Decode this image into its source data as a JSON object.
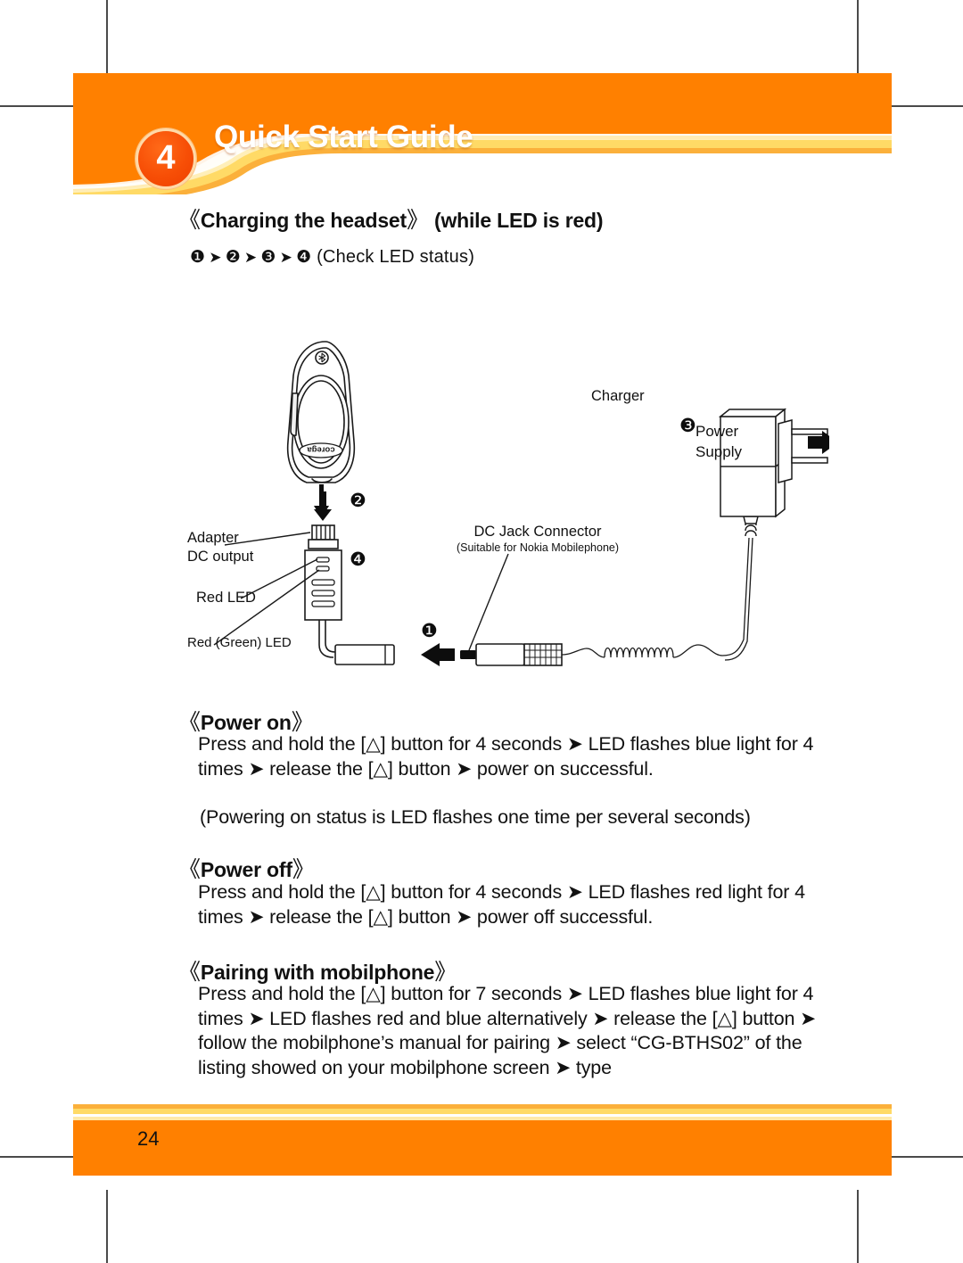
{
  "document": {
    "page_number": "24",
    "header_title": "Quick Start Guide",
    "badge_number": "4"
  },
  "colors": {
    "header_orange": "#FF8000",
    "badge_red": "#F74E06",
    "ribbon_yellow": "#FFDA66",
    "ribbon_gold": "#FBB03B",
    "text_black": "#111111",
    "line_gray": "#4A4A4A"
  },
  "sections": {
    "charging": {
      "open_bracket": "《",
      "title": "Charging the headset",
      "close_bracket": "》",
      "suffix": "(while LED is red)",
      "steps": {
        "items": [
          "❶",
          "❷",
          "❸",
          "❹"
        ],
        "arrow": "➤",
        "note": "(Check LED status)"
      }
    },
    "power_on": {
      "open_bracket": "《",
      "title": "Power on",
      "close_bracket": "》",
      "body": "Press and hold the [△] button for 4 seconds ➤ LED flashes blue light for 4 times ➤ release the [△] button ➤ power on successful.",
      "note": "(Powering on status is LED flashes one time per several seconds)"
    },
    "power_off": {
      "open_bracket": "《",
      "title": "Power off",
      "close_bracket": "》",
      "body": "Press and hold the [△] button for 4 seconds ➤ LED flashes red light for 4 times ➤ release the [△] button ➤ power off successful."
    },
    "pairing": {
      "open_bracket": "《",
      "title": "Pairing with mobilphone",
      "close_bracket": "》",
      "body": "Press and hold the [△] button for 7 seconds ➤ LED flashes blue light for 4 times ➤ LED flashes red and blue alternatively ➤ release the [△] button ➤ follow the mobilphone’s manual for pairing ➤ select “CG-BTHS02” of the listing showed on your mobilphone screen ➤ type"
    }
  },
  "diagram": {
    "callouts": {
      "step1": "❶",
      "step2": "❷",
      "step3": "❸",
      "step4": "❹"
    },
    "labels": {
      "adapter_line1": "Adapter",
      "adapter_line2": "DC output",
      "red_led": "Red LED",
      "red_green_led": "Red (Green) LED",
      "dc_jack_title": "DC Jack Connector",
      "dc_jack_sub": "(Suitable for Nokia Mobilephone)",
      "charger": "Charger",
      "power_supply_line1": "Power",
      "power_supply_line2": "Supply",
      "headset_brand": "corega"
    }
  }
}
